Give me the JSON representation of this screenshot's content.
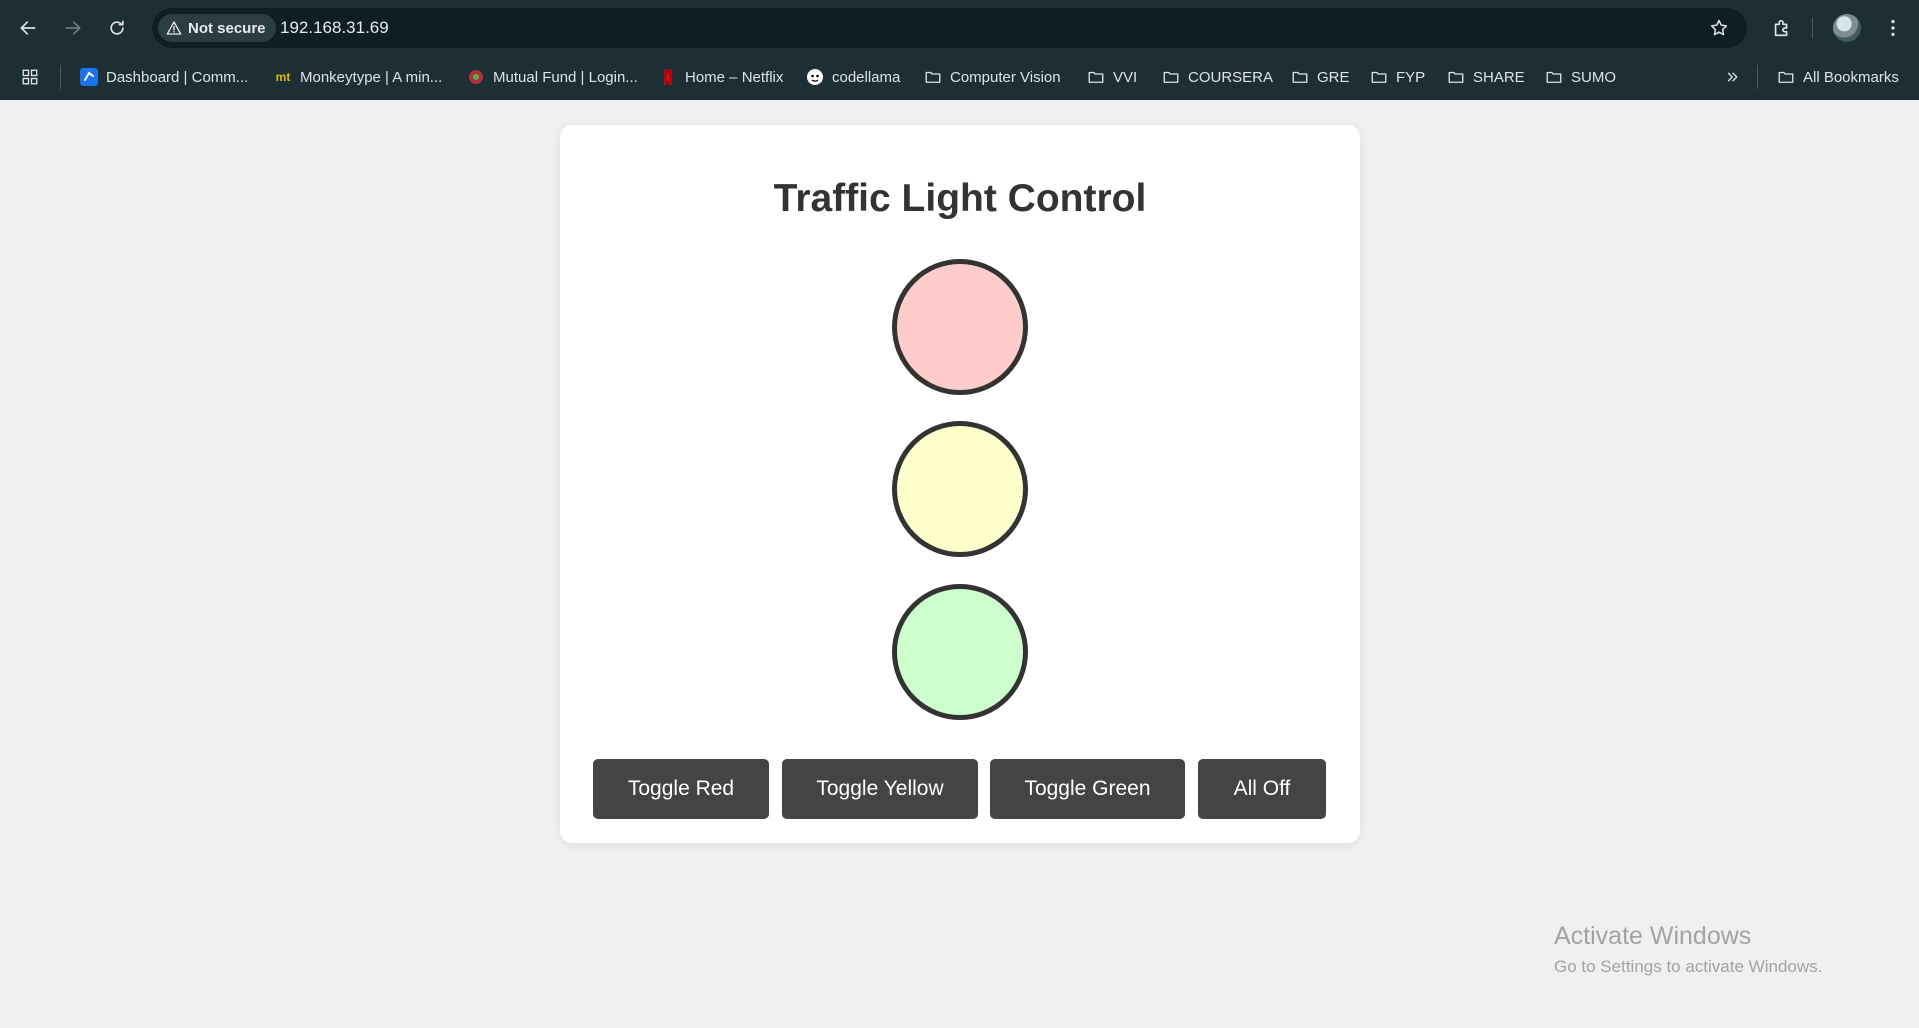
{
  "browser": {
    "security_label": "Not secure",
    "url": "192.168.31.69"
  },
  "bookmarks": {
    "items": [
      {
        "label": "Dashboard | Comm...",
        "icon": "dashboard-favicon"
      },
      {
        "label": "Monkeytype | A min...",
        "icon": "monkeytype-favicon",
        "icon_text": "mt"
      },
      {
        "label": "Mutual Fund | Login...",
        "icon": "mutual-fund-favicon"
      },
      {
        "label": "Home – Netflix",
        "icon": "netflix-favicon"
      },
      {
        "label": "codellama",
        "icon": "codellama-favicon"
      },
      {
        "label": "Computer Vision",
        "icon": "folder-icon"
      },
      {
        "label": "VVI",
        "icon": "folder-icon"
      },
      {
        "label": "COURSERA",
        "icon": "folder-icon"
      },
      {
        "label": "GRE",
        "icon": "folder-icon"
      },
      {
        "label": "FYP",
        "icon": "folder-icon"
      },
      {
        "label": "SHARE",
        "icon": "folder-icon"
      },
      {
        "label": "SUMO",
        "icon": "folder-icon"
      }
    ],
    "all_bookmarks_label": "All Bookmarks"
  },
  "page": {
    "title": "Traffic Light Control",
    "lights": [
      {
        "name": "red",
        "color": "#ffcccc"
      },
      {
        "name": "yellow",
        "color": "#ffffcc"
      },
      {
        "name": "green",
        "color": "#ccffcc"
      }
    ],
    "buttons": {
      "toggle_red": "Toggle Red",
      "toggle_yellow": "Toggle Yellow",
      "toggle_green": "Toggle Green",
      "all_off": "All Off"
    }
  },
  "watermark": {
    "title": "Activate Windows",
    "subtitle": "Go to Settings to activate Windows."
  },
  "colors": {
    "chrome_bg": "#1e2e35",
    "page_bg": "#f0f0f0",
    "button_bg": "#444444",
    "light_border": "#333333"
  }
}
